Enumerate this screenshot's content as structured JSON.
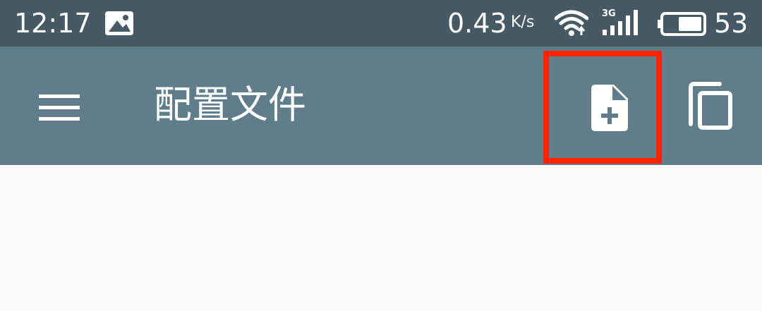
{
  "status_bar": {
    "time": "12:17",
    "net_speed": "0.43",
    "net_speed_unit": "K/s",
    "network_type": "3G",
    "battery_level": "53",
    "icons": [
      "gallery-notification-icon",
      "wifi-icon",
      "signal-icon",
      "battery-icon"
    ]
  },
  "app_bar": {
    "title": "配置文件",
    "icons": {
      "menu": "hamburger-menu-icon",
      "new_file": "new-file-icon",
      "copy": "copy-icon"
    }
  },
  "colors": {
    "status_bar_bg": "#455a64",
    "app_bar_bg": "#607d8b",
    "content_bg": "#fafafa",
    "highlight": "#ff2200",
    "foreground": "#ffffff"
  }
}
